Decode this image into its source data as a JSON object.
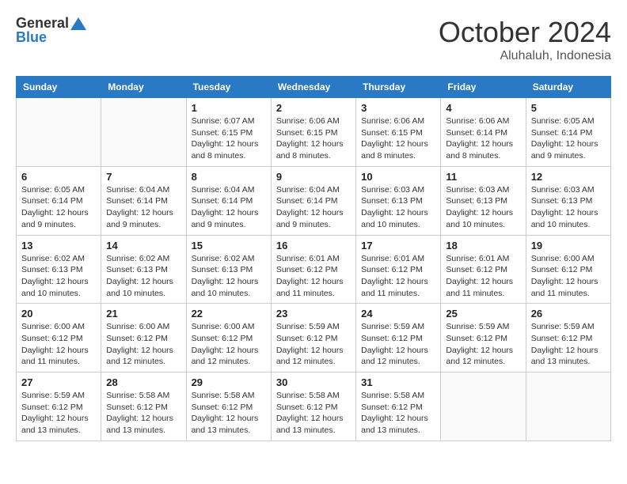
{
  "header": {
    "logo_line1": "General",
    "logo_line2": "Blue",
    "month_year": "October 2024",
    "location": "Aluhaluh, Indonesia"
  },
  "weekdays": [
    "Sunday",
    "Monday",
    "Tuesday",
    "Wednesday",
    "Thursday",
    "Friday",
    "Saturday"
  ],
  "weeks": [
    [
      {
        "day": "",
        "info": ""
      },
      {
        "day": "",
        "info": ""
      },
      {
        "day": "1",
        "info": "Sunrise: 6:07 AM\nSunset: 6:15 PM\nDaylight: 12 hours and 8 minutes."
      },
      {
        "day": "2",
        "info": "Sunrise: 6:06 AM\nSunset: 6:15 PM\nDaylight: 12 hours and 8 minutes."
      },
      {
        "day": "3",
        "info": "Sunrise: 6:06 AM\nSunset: 6:15 PM\nDaylight: 12 hours and 8 minutes."
      },
      {
        "day": "4",
        "info": "Sunrise: 6:06 AM\nSunset: 6:14 PM\nDaylight: 12 hours and 8 minutes."
      },
      {
        "day": "5",
        "info": "Sunrise: 6:05 AM\nSunset: 6:14 PM\nDaylight: 12 hours and 9 minutes."
      }
    ],
    [
      {
        "day": "6",
        "info": "Sunrise: 6:05 AM\nSunset: 6:14 PM\nDaylight: 12 hours and 9 minutes."
      },
      {
        "day": "7",
        "info": "Sunrise: 6:04 AM\nSunset: 6:14 PM\nDaylight: 12 hours and 9 minutes."
      },
      {
        "day": "8",
        "info": "Sunrise: 6:04 AM\nSunset: 6:14 PM\nDaylight: 12 hours and 9 minutes."
      },
      {
        "day": "9",
        "info": "Sunrise: 6:04 AM\nSunset: 6:14 PM\nDaylight: 12 hours and 9 minutes."
      },
      {
        "day": "10",
        "info": "Sunrise: 6:03 AM\nSunset: 6:13 PM\nDaylight: 12 hours and 10 minutes."
      },
      {
        "day": "11",
        "info": "Sunrise: 6:03 AM\nSunset: 6:13 PM\nDaylight: 12 hours and 10 minutes."
      },
      {
        "day": "12",
        "info": "Sunrise: 6:03 AM\nSunset: 6:13 PM\nDaylight: 12 hours and 10 minutes."
      }
    ],
    [
      {
        "day": "13",
        "info": "Sunrise: 6:02 AM\nSunset: 6:13 PM\nDaylight: 12 hours and 10 minutes."
      },
      {
        "day": "14",
        "info": "Sunrise: 6:02 AM\nSunset: 6:13 PM\nDaylight: 12 hours and 10 minutes."
      },
      {
        "day": "15",
        "info": "Sunrise: 6:02 AM\nSunset: 6:13 PM\nDaylight: 12 hours and 10 minutes."
      },
      {
        "day": "16",
        "info": "Sunrise: 6:01 AM\nSunset: 6:12 PM\nDaylight: 12 hours and 11 minutes."
      },
      {
        "day": "17",
        "info": "Sunrise: 6:01 AM\nSunset: 6:12 PM\nDaylight: 12 hours and 11 minutes."
      },
      {
        "day": "18",
        "info": "Sunrise: 6:01 AM\nSunset: 6:12 PM\nDaylight: 12 hours and 11 minutes."
      },
      {
        "day": "19",
        "info": "Sunrise: 6:00 AM\nSunset: 6:12 PM\nDaylight: 12 hours and 11 minutes."
      }
    ],
    [
      {
        "day": "20",
        "info": "Sunrise: 6:00 AM\nSunset: 6:12 PM\nDaylight: 12 hours and 11 minutes."
      },
      {
        "day": "21",
        "info": "Sunrise: 6:00 AM\nSunset: 6:12 PM\nDaylight: 12 hours and 12 minutes."
      },
      {
        "day": "22",
        "info": "Sunrise: 6:00 AM\nSunset: 6:12 PM\nDaylight: 12 hours and 12 minutes."
      },
      {
        "day": "23",
        "info": "Sunrise: 5:59 AM\nSunset: 6:12 PM\nDaylight: 12 hours and 12 minutes."
      },
      {
        "day": "24",
        "info": "Sunrise: 5:59 AM\nSunset: 6:12 PM\nDaylight: 12 hours and 12 minutes."
      },
      {
        "day": "25",
        "info": "Sunrise: 5:59 AM\nSunset: 6:12 PM\nDaylight: 12 hours and 12 minutes."
      },
      {
        "day": "26",
        "info": "Sunrise: 5:59 AM\nSunset: 6:12 PM\nDaylight: 12 hours and 13 minutes."
      }
    ],
    [
      {
        "day": "27",
        "info": "Sunrise: 5:59 AM\nSunset: 6:12 PM\nDaylight: 12 hours and 13 minutes."
      },
      {
        "day": "28",
        "info": "Sunrise: 5:58 AM\nSunset: 6:12 PM\nDaylight: 12 hours and 13 minutes."
      },
      {
        "day": "29",
        "info": "Sunrise: 5:58 AM\nSunset: 6:12 PM\nDaylight: 12 hours and 13 minutes."
      },
      {
        "day": "30",
        "info": "Sunrise: 5:58 AM\nSunset: 6:12 PM\nDaylight: 12 hours and 13 minutes."
      },
      {
        "day": "31",
        "info": "Sunrise: 5:58 AM\nSunset: 6:12 PM\nDaylight: 12 hours and 13 minutes."
      },
      {
        "day": "",
        "info": ""
      },
      {
        "day": "",
        "info": ""
      }
    ]
  ]
}
